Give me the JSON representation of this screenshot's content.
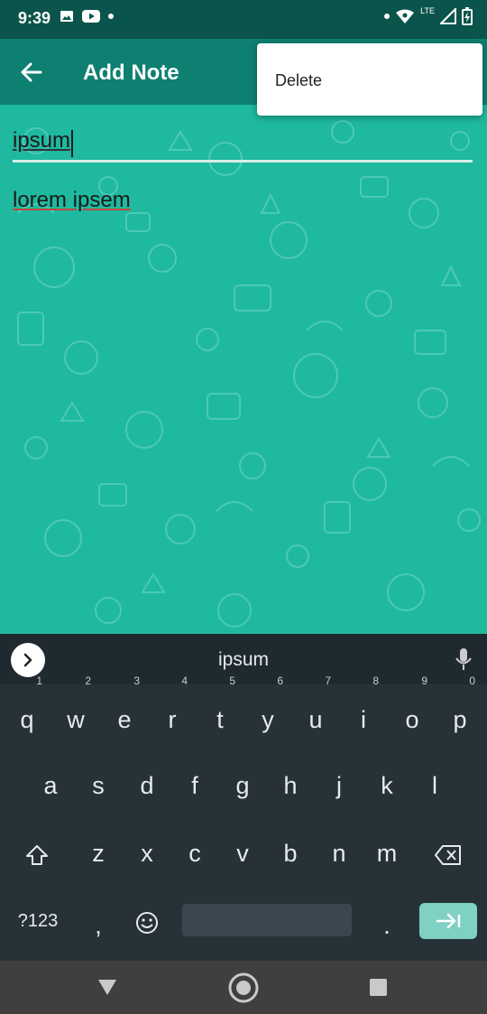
{
  "status_bar": {
    "time": "9:39",
    "network": "LTE"
  },
  "app_bar": {
    "title": "Add Note"
  },
  "menu": {
    "items": [
      {
        "label": "Delete"
      }
    ]
  },
  "note": {
    "title_value": "ipsum",
    "body_value": "lorem ipsem"
  },
  "keyboard": {
    "suggestion": "ipsum",
    "row1": [
      {
        "key": "q",
        "num": "1"
      },
      {
        "key": "w",
        "num": "2"
      },
      {
        "key": "e",
        "num": "3"
      },
      {
        "key": "r",
        "num": "4"
      },
      {
        "key": "t",
        "num": "5"
      },
      {
        "key": "y",
        "num": "6"
      },
      {
        "key": "u",
        "num": "7"
      },
      {
        "key": "i",
        "num": "8"
      },
      {
        "key": "o",
        "num": "9"
      },
      {
        "key": "p",
        "num": "0"
      }
    ],
    "row2": [
      "a",
      "s",
      "d",
      "f",
      "g",
      "h",
      "j",
      "k",
      "l"
    ],
    "row3": [
      "z",
      "x",
      "c",
      "v",
      "b",
      "n",
      "m"
    ],
    "symbols_label": "?123",
    "comma": ",",
    "period": "."
  },
  "colors": {
    "status_bar": "#0b544b",
    "app_bar": "#0d8071",
    "background": "#1fb99f",
    "keyboard": "#263238",
    "enter_key": "#7fd1c4",
    "nav_bar": "#3f3f3f"
  }
}
